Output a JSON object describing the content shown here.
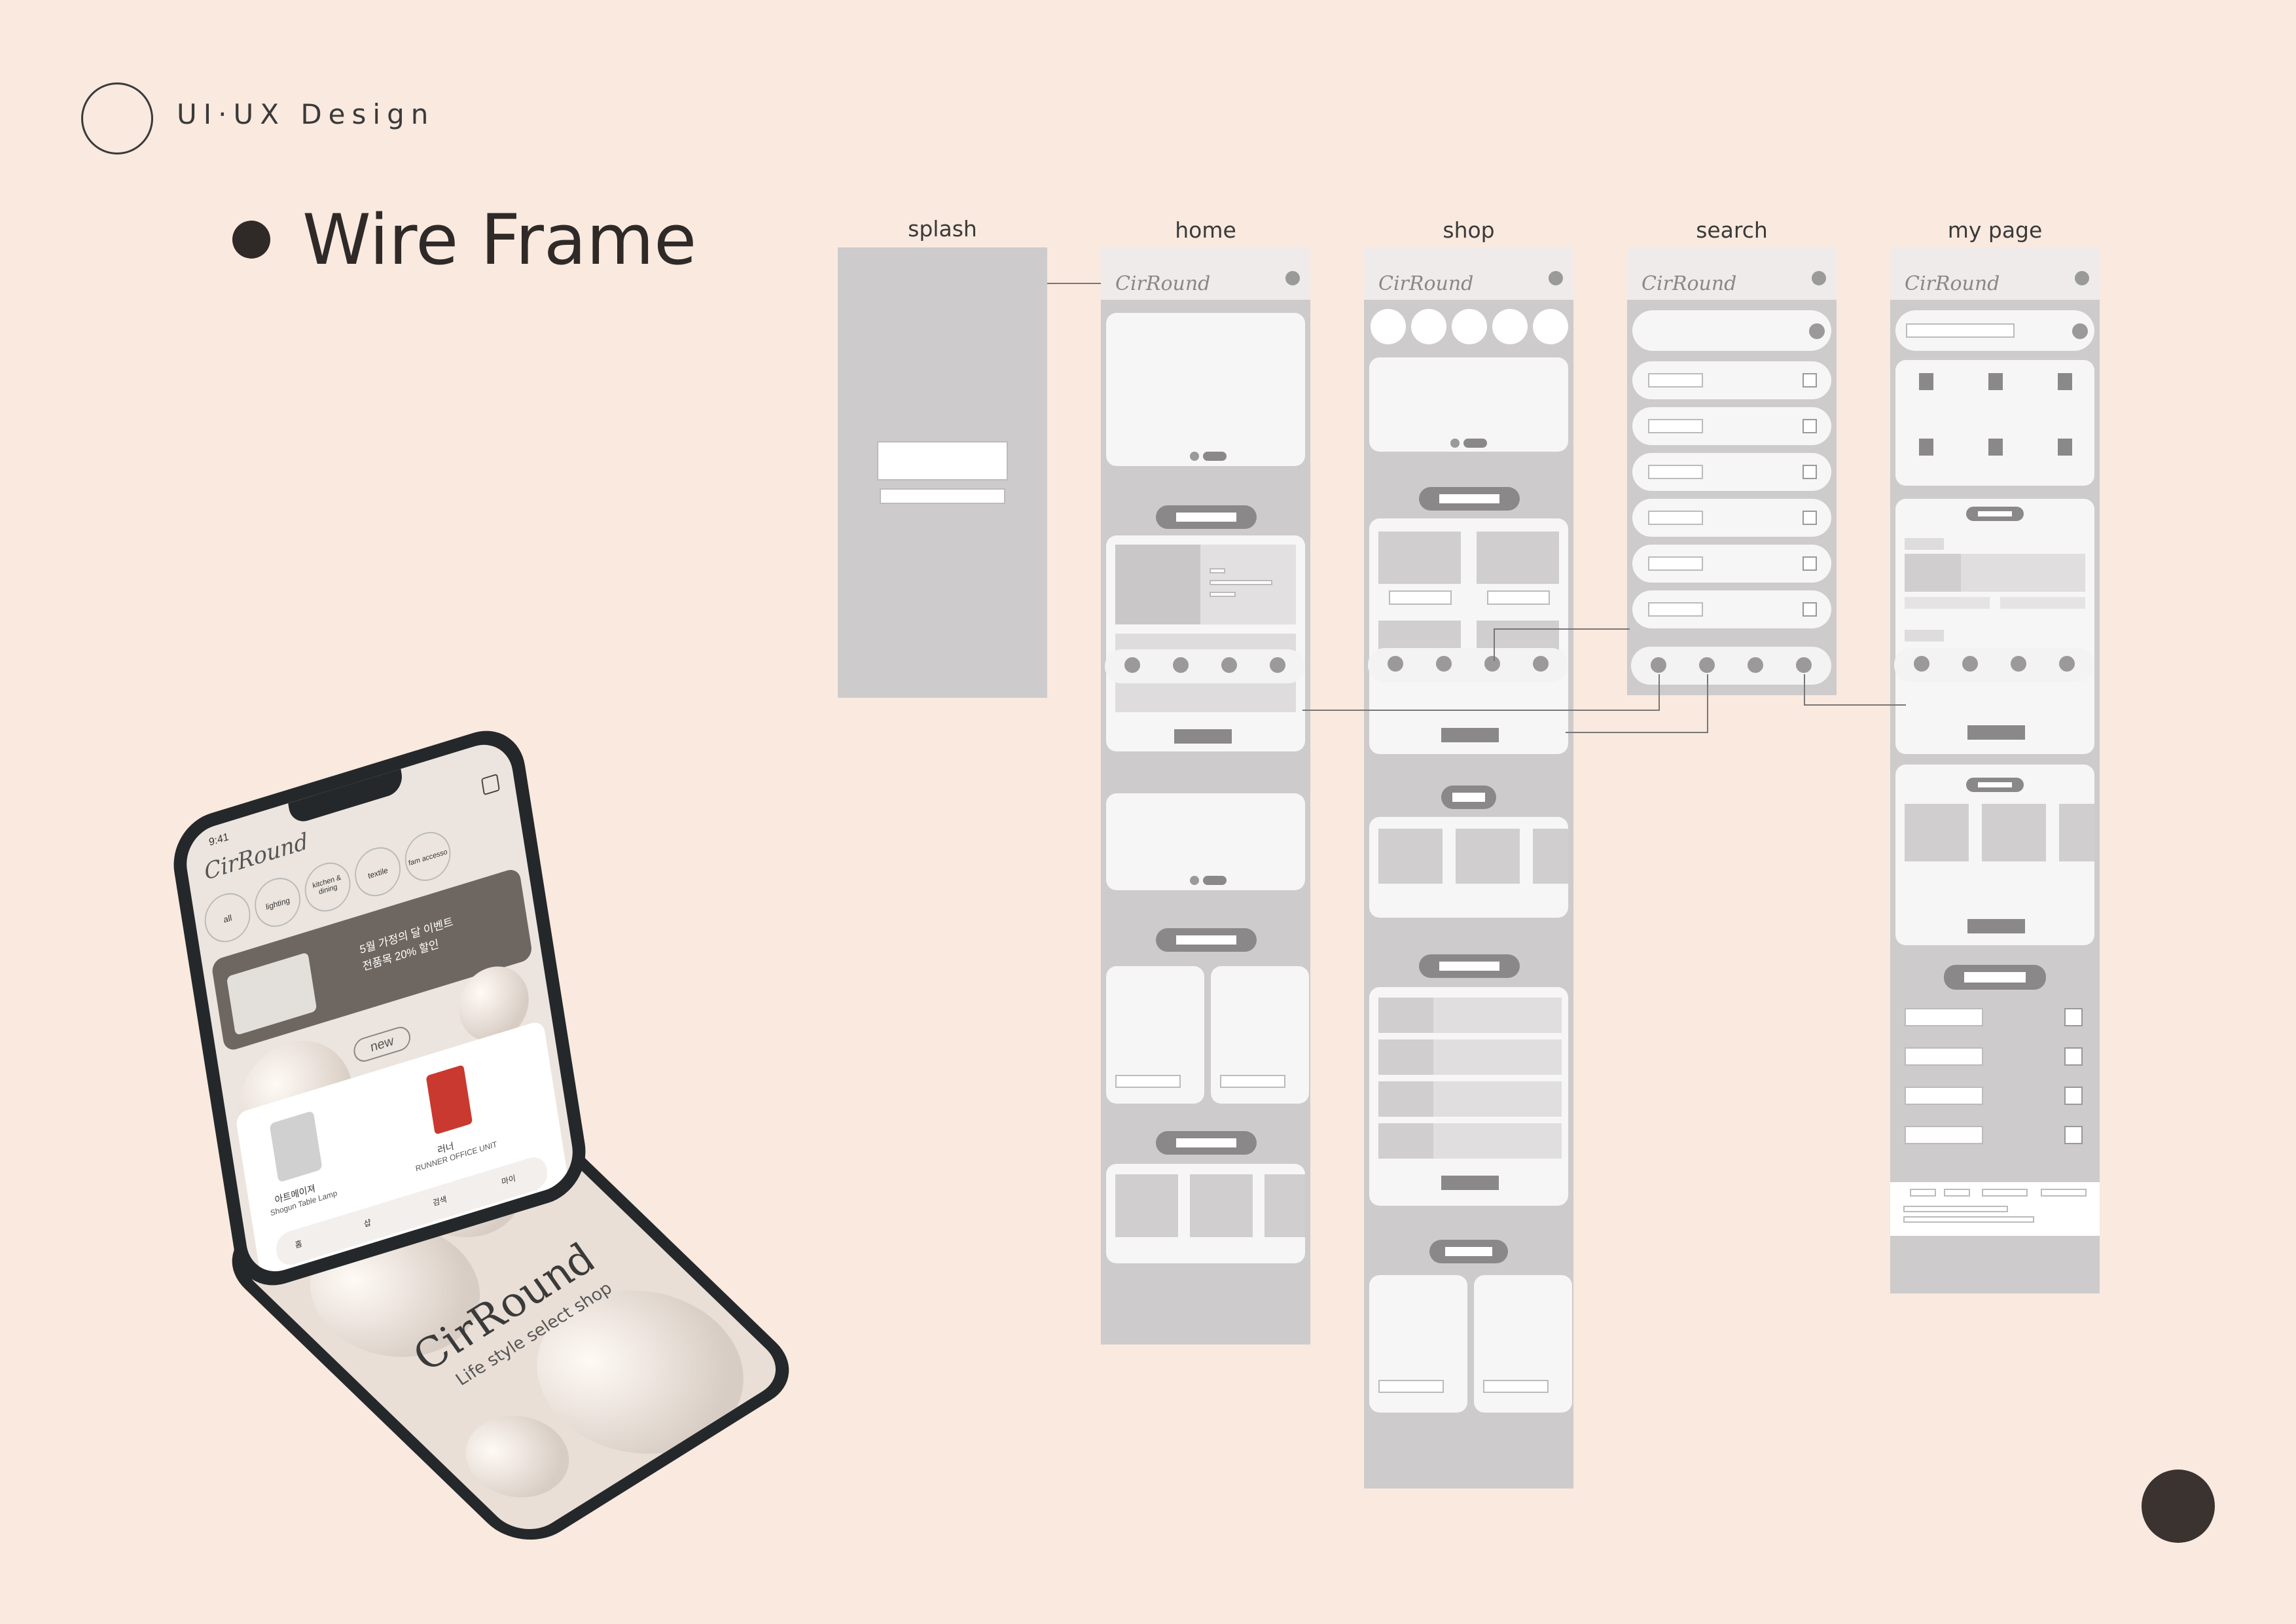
{
  "header": {
    "brand": "UI·UX Design",
    "title": "Wire Frame"
  },
  "screens": {
    "splash": "splash",
    "home": "home",
    "shop": "shop",
    "search": "search",
    "my_page": "my page"
  },
  "app_brand": "CirRound",
  "phone": {
    "time": "9:41",
    "categories": [
      "all",
      "lighting",
      "kitchen & dining",
      "textile",
      "fam accesso"
    ],
    "banner_line1": "5월 가정의 달 이벤트",
    "banner_line2": "전품목 20% 할인",
    "section_new": "new",
    "product1_kr": "아트메이져",
    "product1_en": "Shogun Table Lamp",
    "product2_kr": "러너",
    "product2_en": "RUNNER OFFICE UNIT",
    "nav": [
      "홈",
      "샵",
      "검색",
      "마이"
    ],
    "tagline": "Life style select shop"
  }
}
